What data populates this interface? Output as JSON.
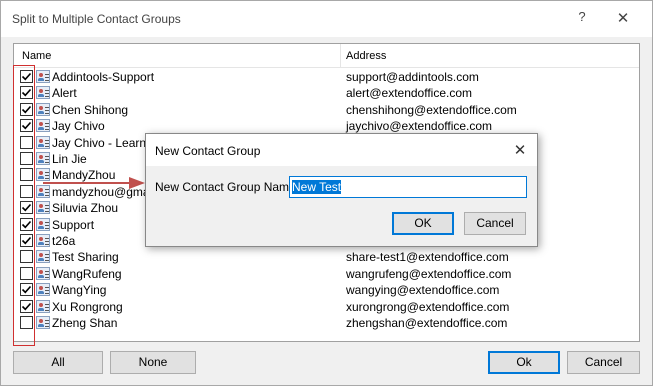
{
  "window": {
    "title": "Split to Multiple Contact Groups",
    "help_glyph": "?",
    "close_glyph": "✕"
  },
  "list": {
    "columns": {
      "name": "Name",
      "address": "Address"
    },
    "rows": [
      {
        "name": "Addintools-Support",
        "address": "support@addintools.com",
        "checked": true
      },
      {
        "name": "Alert",
        "address": "alert@extendoffice.com",
        "checked": true
      },
      {
        "name": "Chen Shihong",
        "address": "chenshihong@extendoffice.com",
        "checked": true
      },
      {
        "name": "Jay Chivo",
        "address": "jaychivo@extendoffice.com",
        "checked": true
      },
      {
        "name": "Jay Chivo - LearnOf",
        "address": "",
        "checked": false
      },
      {
        "name": "Lin Jie",
        "address": "",
        "checked": false
      },
      {
        "name": "MandyZhou",
        "address": "",
        "checked": false
      },
      {
        "name": "mandyzhou@gmail",
        "address": "",
        "checked": false
      },
      {
        "name": "Siluvia Zhou",
        "address": "",
        "checked": true
      },
      {
        "name": "Support",
        "address": "",
        "checked": true
      },
      {
        "name": "t26a",
        "address": "t26a@extendoffice.com",
        "checked": true
      },
      {
        "name": "Test Sharing",
        "address": "share-test1@extendoffice.com",
        "checked": false
      },
      {
        "name": "WangRufeng",
        "address": "wangrufeng@extendoffice.com",
        "checked": false
      },
      {
        "name": "WangYing",
        "address": "wangying@extendoffice.com",
        "checked": true
      },
      {
        "name": "Xu Rongrong",
        "address": "xurongrong@extendoffice.com",
        "checked": true
      },
      {
        "name": "Zheng Shan",
        "address": "zhengshan@extendoffice.com",
        "checked": false
      }
    ]
  },
  "buttons": {
    "all": "All",
    "none": "None",
    "ok": "Ok",
    "cancel": "Cancel"
  },
  "dialog": {
    "title": "New Contact Group",
    "close_glyph": "✕",
    "label": "New Contact Group Name:",
    "value": "New Test",
    "ok": "OK",
    "cancel": "Cancel"
  },
  "colors": {
    "accent": "#0078d7",
    "highlight_box": "#d03030",
    "arrow": "#c0504d"
  }
}
